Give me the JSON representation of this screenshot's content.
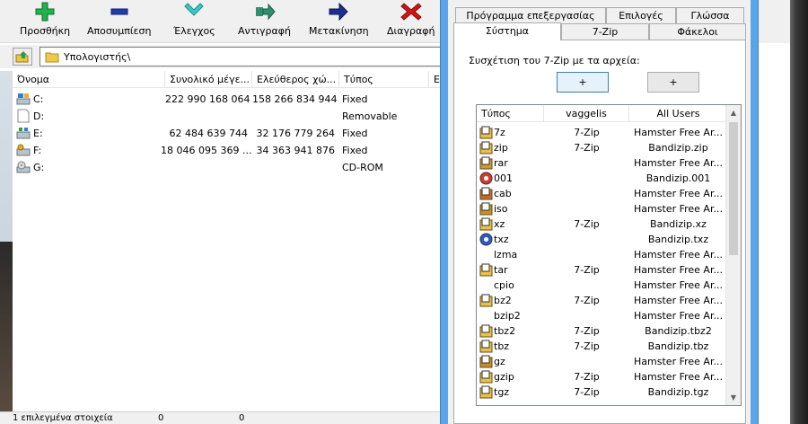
{
  "toolbar": {
    "buttons": [
      {
        "id": "add",
        "label": "Προσθήκη",
        "icon": "plus-icon",
        "color": "#22b14c"
      },
      {
        "id": "extract",
        "label": "Αποσυμπίεση",
        "icon": "minus-icon",
        "color": "#1f3da5"
      },
      {
        "id": "test",
        "label": "Έλεγχος",
        "icon": "check-chevron-icon",
        "color": "#3cc8c8"
      },
      {
        "id": "copy",
        "label": "Αντιγραφή",
        "icon": "copy-arrow-icon",
        "color": "#2f8f6f"
      },
      {
        "id": "move",
        "label": "Μετακίνηση",
        "icon": "move-arrow-icon",
        "color": "#1f2f8f"
      },
      {
        "id": "delete",
        "label": "Διαγραφή",
        "icon": "x-icon",
        "color": "#d41414"
      }
    ]
  },
  "address": {
    "path": "Υπολογιστής\\"
  },
  "file_list": {
    "columns": [
      "Όνομα",
      "Συνολικό μέγε...",
      "Ελεύθερος χώ...",
      "Τύπος",
      "Ετ"
    ],
    "rows": [
      {
        "name": "C:",
        "total": "222 990 168 064",
        "free": "158 266 834 944",
        "type": "Fixed",
        "icon": "system-drive-icon"
      },
      {
        "name": "D:",
        "total": "",
        "free": "",
        "type": "Removable",
        "icon": "removable-drive-icon"
      },
      {
        "name": "E:",
        "total": "62 484 639 744",
        "free": "32 176 779 264",
        "type": "Fixed",
        "icon": "drive-icon"
      },
      {
        "name": "F:",
        "total": "18 046 095 369 ...",
        "free": "34 363 941 876",
        "type": "Fixed",
        "icon": "network-drive-icon"
      },
      {
        "name": "G:",
        "total": "",
        "free": "",
        "type": "CD-ROM",
        "icon": "cd-drive-icon"
      }
    ]
  },
  "status": {
    "selected": "1 επιλεγμένα στοιχεία",
    "size1": "0",
    "size2": "0"
  },
  "dialog": {
    "tabs_row1": [
      "Πρόγραμμα επεξεργασίας",
      "Επιλογές",
      "Γλώσσα"
    ],
    "tabs_row2": [
      "Σύστημα",
      "7-Zip",
      "Φάκελοι"
    ],
    "active_tab": "Σύστημα",
    "assoc_label": "Συσχέτιση του 7-Zip με τα αρχεία:",
    "plus_user": "+",
    "plus_all": "+",
    "list_columns": [
      "Τύπος",
      "vaggelis",
      "All Users"
    ],
    "associations": [
      {
        "ext": "7z",
        "user": "7-Zip",
        "all": "Hamster Free Ar...",
        "icon": "7z-icon"
      },
      {
        "ext": "zip",
        "user": "7-Zip",
        "all": "Bandizip.zip",
        "icon": "zip-icon"
      },
      {
        "ext": "rar",
        "user": "",
        "all": "Hamster Free Ar...",
        "icon": "rar-icon"
      },
      {
        "ext": "001",
        "user": "",
        "all": "Bandizip.001",
        "icon": "001-icon"
      },
      {
        "ext": "cab",
        "user": "",
        "all": "Hamster Free Ar...",
        "icon": "cab-icon"
      },
      {
        "ext": "iso",
        "user": "",
        "all": "Hamster Free Ar...",
        "icon": "iso-icon"
      },
      {
        "ext": "xz",
        "user": "7-Zip",
        "all": "Bandizip.xz",
        "icon": "xz-icon"
      },
      {
        "ext": "txz",
        "user": "",
        "all": "Bandizip.txz",
        "icon": "txz-icon"
      },
      {
        "ext": "lzma",
        "user": "",
        "all": "Hamster Free Ar...",
        "icon": ""
      },
      {
        "ext": "tar",
        "user": "7-Zip",
        "all": "Hamster Free Ar...",
        "icon": "tar-icon"
      },
      {
        "ext": "cpio",
        "user": "",
        "all": "Hamster Free Ar...",
        "icon": ""
      },
      {
        "ext": "bz2",
        "user": "7-Zip",
        "all": "Hamster Free Ar...",
        "icon": "bz2-icon"
      },
      {
        "ext": "bzip2",
        "user": "",
        "all": "Hamster Free Ar...",
        "icon": ""
      },
      {
        "ext": "tbz2",
        "user": "7-Zip",
        "all": "Bandizip.tbz2",
        "icon": "tbz2-icon"
      },
      {
        "ext": "tbz",
        "user": "7-Zip",
        "all": "Bandizip.tbz",
        "icon": "tbz-icon"
      },
      {
        "ext": "gz",
        "user": "",
        "all": "Hamster Free Ar...",
        "icon": "gz-icon"
      },
      {
        "ext": "gzip",
        "user": "7-Zip",
        "all": "Hamster Free Ar...",
        "icon": "gzip-icon"
      },
      {
        "ext": "tgz",
        "user": "7-Zip",
        "all": "Bandizip.tgz",
        "icon": "tgz-icon"
      }
    ]
  },
  "colors": {
    "dialog_frame": "#5aa5e8",
    "button_focus": "#3c7fb1"
  }
}
